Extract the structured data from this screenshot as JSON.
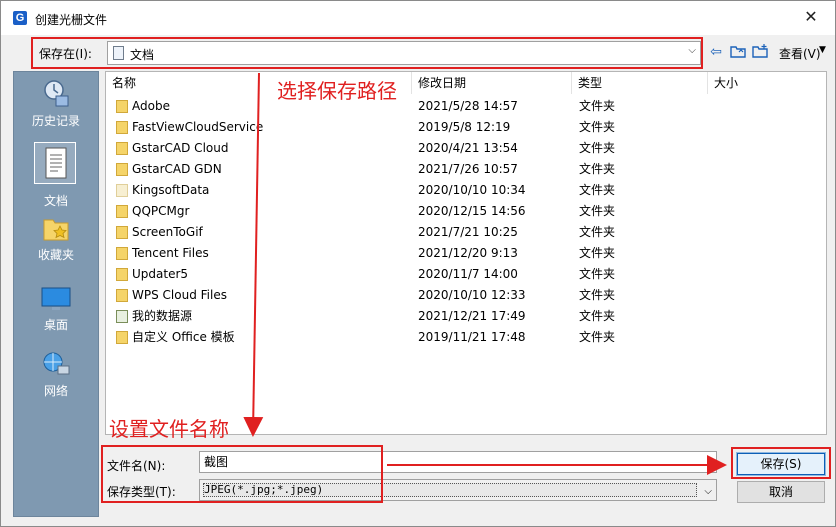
{
  "window": {
    "title": "创建光栅文件",
    "app_icon_letter": "G",
    "close_symbol": "✕"
  },
  "toolbar": {
    "save_in_label": "保存在(I):",
    "save_in_value": "文档",
    "view_label": "查看(V)"
  },
  "places": [
    {
      "label": "历史记录",
      "icon": "history-icon"
    },
    {
      "label": "文档",
      "icon": "documents-icon",
      "selected": true
    },
    {
      "label": "收藏夹",
      "icon": "favorites-icon"
    },
    {
      "label": "桌面",
      "icon": "desktop-icon"
    },
    {
      "label": "网络",
      "icon": "network-icon"
    }
  ],
  "columns": [
    "名称",
    "修改日期",
    "类型",
    "大小"
  ],
  "files": [
    {
      "name": "Adobe",
      "date": "2021/5/28 14:57",
      "type": "文件夹",
      "icon": "folder"
    },
    {
      "name": "FastViewCloudService",
      "date": "2019/5/8 12:19",
      "type": "文件夹",
      "icon": "folder"
    },
    {
      "name": "GstarCAD Cloud",
      "date": "2020/4/21 13:54",
      "type": "文件夹",
      "icon": "folder"
    },
    {
      "name": "GstarCAD GDN",
      "date": "2021/7/26 10:57",
      "type": "文件夹",
      "icon": "folder"
    },
    {
      "name": "KingsoftData",
      "date": "2020/10/10 10:34",
      "type": "文件夹",
      "icon": "folder-pale"
    },
    {
      "name": "QQPCMgr",
      "date": "2020/12/15 14:56",
      "type": "文件夹",
      "icon": "folder"
    },
    {
      "name": "ScreenToGif",
      "date": "2021/7/21 10:25",
      "type": "文件夹",
      "icon": "folder"
    },
    {
      "name": "Tencent Files",
      "date": "2021/12/20 9:13",
      "type": "文件夹",
      "icon": "folder"
    },
    {
      "name": "Updater5",
      "date": "2020/11/7 14:00",
      "type": "文件夹",
      "icon": "folder"
    },
    {
      "name": "WPS Cloud Files",
      "date": "2020/10/10 12:33",
      "type": "文件夹",
      "icon": "folder"
    },
    {
      "name": "我的数据源",
      "date": "2021/12/21 17:49",
      "type": "文件夹",
      "icon": "folder-special"
    },
    {
      "name": "自定义 Office 模板",
      "date": "2019/11/21 17:48",
      "type": "文件夹",
      "icon": "folder"
    }
  ],
  "annotations": {
    "path_note": "选择保存路径",
    "name_note": "设置文件名称"
  },
  "bottom": {
    "filename_label": "文件名(N):",
    "filename_value": "截图",
    "filetype_label": "保存类型(T):",
    "filetype_value": "JPEG(*.jpg;*.jpeg)",
    "save_button": "保存(S)",
    "cancel_button": "取消"
  },
  "colors": {
    "annotation": "#e02020",
    "places_bg": "#7f99b1",
    "folder": "#f5d469"
  }
}
